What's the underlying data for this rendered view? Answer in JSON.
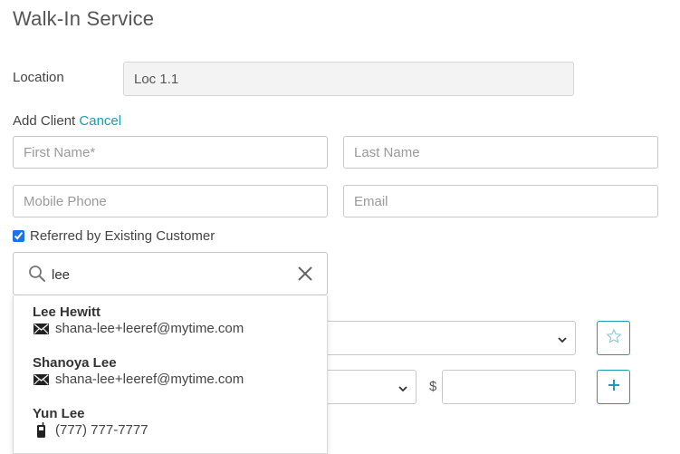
{
  "page": {
    "title": "Walk-In Service"
  },
  "location": {
    "label": "Location",
    "value": "Loc 1.1"
  },
  "add_client": {
    "label": "Add Client",
    "cancel_label": "Cancel",
    "first_name_placeholder": "First Name*",
    "last_name_placeholder": "Last Name",
    "mobile_phone_placeholder": "Mobile Phone",
    "email_placeholder": "Email"
  },
  "referral": {
    "checkbox_label": "Referred by Existing Customer",
    "checked": true,
    "search_value": "lee",
    "results": [
      {
        "name": "Lee Hewitt",
        "detail": "shana-lee+leeref@mytime.com",
        "icon": "envelope-icon"
      },
      {
        "name": "Shanoya Lee",
        "detail": "shana-lee+leeref@mytime.com",
        "icon": "envelope-icon"
      },
      {
        "name": "Yun Lee",
        "detail": "(777) 777-7777",
        "icon": "mobile-phone-icon"
      }
    ]
  },
  "pricing": {
    "currency_symbol": "$"
  },
  "colors": {
    "accent": "#1d9bb0",
    "checkbox": "#1a73e8"
  }
}
